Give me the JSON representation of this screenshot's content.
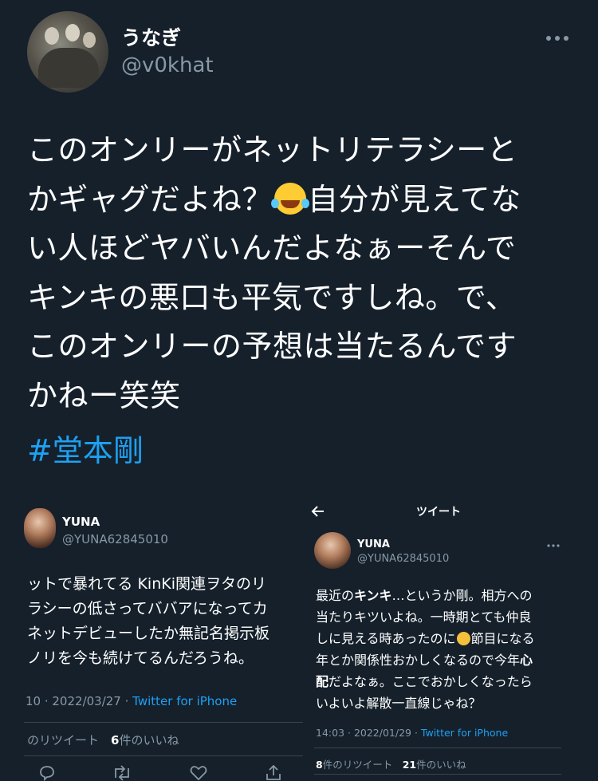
{
  "tweet": {
    "display_name": "うなぎ",
    "handle": "@v0khat",
    "more_icon": "more-horizontal-icon",
    "lines": [
      "このオンリーがネットリテラシーと",
      "かギャグだよね？",
      "自分が見えてな",
      "い人ほどヤバいんだよなぁーそんで",
      "キンキの悪口も平気ですしね。で、",
      "このオンリーの予想は当たるんです",
      "かねー笑笑"
    ],
    "emoji": "face-with-tears-of-joy",
    "hashtag": "#堂本剛"
  },
  "screenshot_left": {
    "name": "YUNA",
    "handle": "@YUNA62845010",
    "lines": [
      "ットで暴れてる KinKi関連ヲタのリ",
      "ラシーの低さってババアになってカ",
      "ネットデビューしたか無記名掲示板",
      "ノリを今も続けてるんだろうね。"
    ],
    "meta_time": "10 · 2022/03/27 · ",
    "meta_source": "Twitter for iPhone",
    "retweet_label": "のリツイート",
    "likes_count": "6",
    "likes_label": "件のいいね"
  },
  "screenshot_right": {
    "header_title": "ツイート",
    "name": "YUNA",
    "handle": "@YUNA62845010",
    "line1_a": "最近の",
    "line1_bold": "キンキ",
    "line1_b": "…というか剛。相方への",
    "line2": "当たりキツいよね。一時期とても仲良",
    "line3_a": "しに見える時あったのに",
    "line3_b": "節目になる",
    "line4_a": "年とか関係性おかしくなるので今年",
    "line4_bold": "心",
    "line5_bold": "配",
    "line5_b": "だよなぁ。ここでおかしくなったら",
    "line6": "いよいよ解散一直線じゃね？",
    "meta_time": "14:03 · 2022/01/29 · ",
    "meta_source": "Twitter for iPhone",
    "retweets_count": "8",
    "retweets_label": "件のリツイート",
    "likes_count": "21",
    "likes_label": "件のいいね"
  },
  "colors": {
    "background": "#15202b",
    "link": "#1da1f2",
    "secondary_text": "#8899a6"
  }
}
